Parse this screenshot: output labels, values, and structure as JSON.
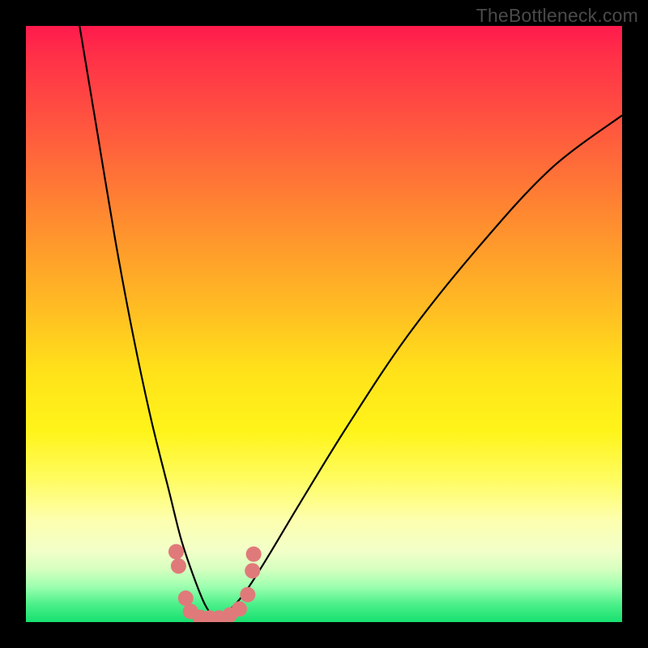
{
  "watermark": "TheBottleneck.com",
  "chart_data": {
    "type": "line",
    "title": "",
    "xlabel": "",
    "ylabel": "",
    "xlim": [
      0,
      100
    ],
    "ylim": [
      0,
      100
    ],
    "description": "V-shaped bottleneck curve over a vertical rainbow gradient (red=high at top → green=low at bottom). Two black curves descend steeply to a shared minimum near x≈30 then rise; pink dotted markers cluster near the trough.",
    "series": [
      {
        "name": "left-branch",
        "x": [
          9,
          12,
          15,
          18,
          21,
          24,
          26,
          28,
          30,
          32
        ],
        "y": [
          100,
          82,
          64,
          48,
          34,
          22,
          14,
          8,
          3,
          0
        ]
      },
      {
        "name": "right-branch",
        "x": [
          32,
          36,
          40,
          46,
          54,
          64,
          76,
          88,
          100
        ],
        "y": [
          0,
          4,
          10,
          20,
          33,
          48,
          63,
          76,
          85
        ]
      }
    ],
    "dots": {
      "name": "trough-markers",
      "color": "#e07a7a",
      "points": [
        {
          "x": 25.2,
          "y": 11.8
        },
        {
          "x": 25.6,
          "y": 9.4
        },
        {
          "x": 26.8,
          "y": 4.0
        },
        {
          "x": 27.6,
          "y": 1.8
        },
        {
          "x": 29.2,
          "y": 0.8
        },
        {
          "x": 30.8,
          "y": 0.7
        },
        {
          "x": 32.4,
          "y": 0.7
        },
        {
          "x": 34.2,
          "y": 1.2
        },
        {
          "x": 35.8,
          "y": 2.2
        },
        {
          "x": 37.2,
          "y": 4.6
        },
        {
          "x": 38.0,
          "y": 8.6
        },
        {
          "x": 38.2,
          "y": 11.4
        }
      ]
    },
    "gradient_stops": [
      {
        "pos": 0.0,
        "color": "#ff1a4d"
      },
      {
        "pos": 0.5,
        "color": "#ffe21a"
      },
      {
        "pos": 1.0,
        "color": "#17e070"
      }
    ]
  }
}
